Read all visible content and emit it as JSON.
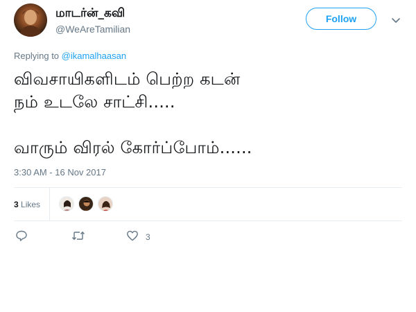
{
  "author": {
    "display_name": "மாடர்ன்_கவி",
    "handle": "@WeAreTamilian",
    "avatar_icon": "profile-avatar"
  },
  "follow_label": "Follow",
  "reply_context": {
    "prefix": "Replying to ",
    "mention": "@ikamalhaasan"
  },
  "tweet_text": "விவசாயிகளிடம் பெற்ற கடன்\nநம் உடலே சாட்சி.....\n\nவாரும் விரல் கோர்ப்போம்......",
  "timestamp": "3:30 AM - 16 Nov 2017",
  "likes": {
    "count": "3",
    "label": "Likes"
  },
  "actions": {
    "reply_icon": "reply-icon",
    "retweet_icon": "retweet-icon",
    "like_icon": "heart-icon",
    "like_count": "3"
  },
  "colors": {
    "accent": "#1da1f2",
    "muted": "#657786",
    "text": "#14171a",
    "divider": "#e6ecf0"
  }
}
